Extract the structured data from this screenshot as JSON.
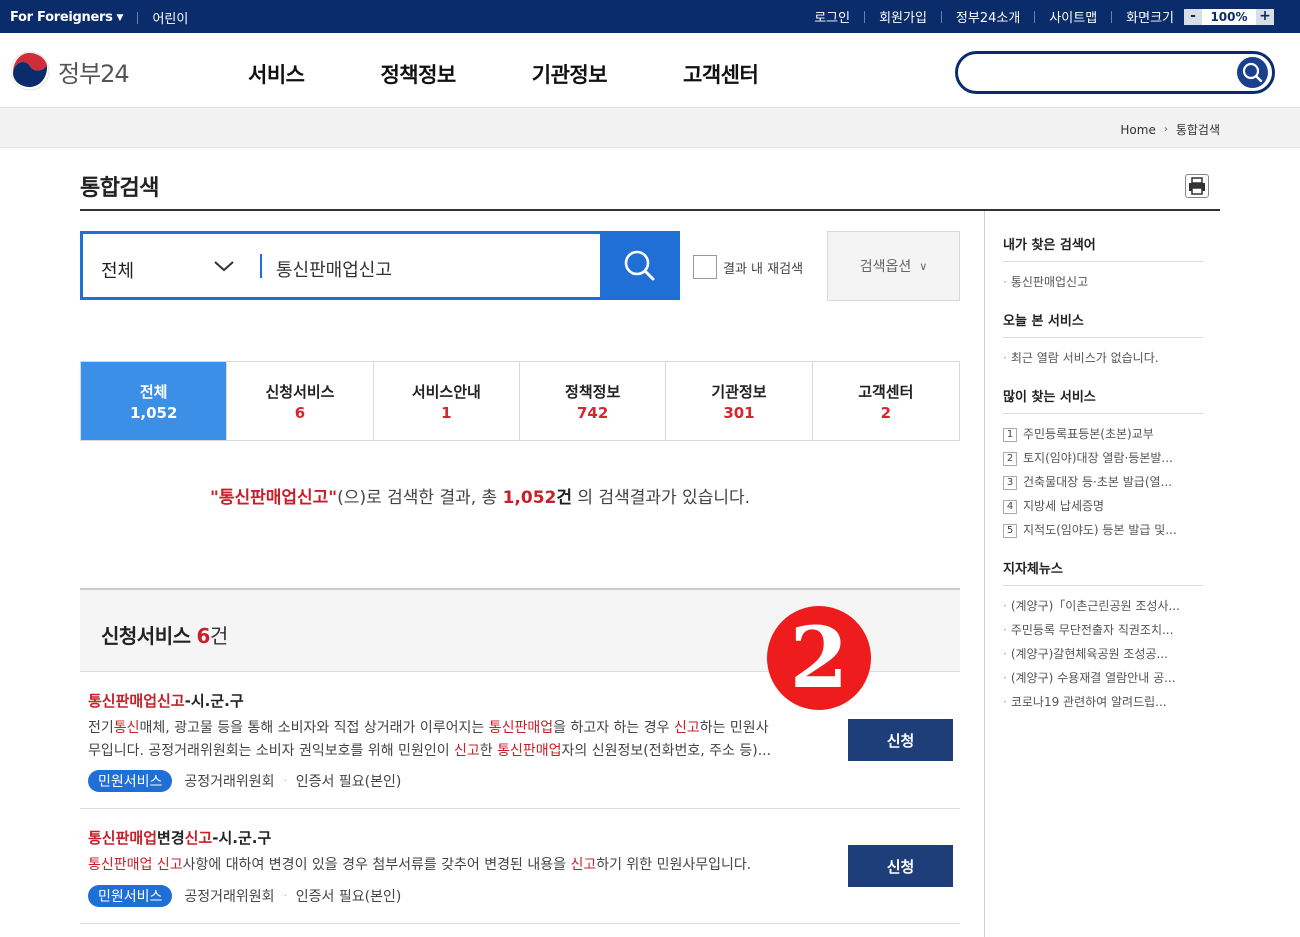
{
  "topbar": {
    "foreigners": "For Foreigners",
    "kids": "어린이",
    "links": [
      "로그인",
      "회원가입",
      "정부24소개",
      "사이트맵"
    ],
    "zoom_label": "화면크기",
    "zoom_minus": "-",
    "zoom_value": "100%",
    "zoom_plus": "+"
  },
  "header": {
    "logo_text": "정부24",
    "nav": [
      "서비스",
      "정책정보",
      "기관정보",
      "고객센터"
    ],
    "search_placeholder": ""
  },
  "breadcrumb": {
    "home": "Home",
    "current": "통합검색"
  },
  "page_title": "통합검색",
  "search": {
    "category": "전체",
    "query": "통신판매업신고",
    "research_label": "결과 내 재검색",
    "options_label": "검색옵션"
  },
  "tabs": [
    {
      "label": "전체",
      "count": "1,052"
    },
    {
      "label": "신청서비스",
      "count": "6"
    },
    {
      "label": "서비스안내",
      "count": "1"
    },
    {
      "label": "정책정보",
      "count": "742"
    },
    {
      "label": "기관정보",
      "count": "301"
    },
    {
      "label": "고객센터",
      "count": "2"
    }
  ],
  "summary": {
    "keyword": "\"통신판매업신고\"",
    "text1": "(으)로 검색한 결과, 총 ",
    "total": "1,052",
    "unit": "건",
    "text2": " 의 검색결과가 있습니다."
  },
  "section": {
    "title": "신청서비스",
    "count": "6",
    "unit": "건"
  },
  "marker": "2",
  "results": [
    {
      "title_hl": "통신판매업신고",
      "title_rest": "-시.군.구",
      "desc_line1": [
        "전기",
        "통신",
        "매체, 광고물 등을 통해 소비자와 직접 상거래가 이루어지는 ",
        "통신판매업",
        "을 하고자 하는 경우 ",
        "신고",
        "하는 민원사"
      ],
      "desc_line2": [
        "무입니다. 공정거래위원회는 소비자 권익보호를 위해 민원인이 ",
        "신고",
        "한 ",
        "통신판매업",
        "자의 신원정보(전화번호, 주소 등)..."
      ],
      "tag": "민원서비스",
      "org": "공정거래위원회",
      "cert": "인증서 필요(본인)",
      "button": "신청"
    },
    {
      "title_hl1": "통신판매업",
      "title_mid": "변경",
      "title_hl2": "신고",
      "title_rest": "-시.군.구",
      "desc_line1": [
        "통신판매업 신고",
        "사항에 대하여 변경이 있을 경우 첨부서류를 갖추어 변경된 내용을 ",
        "신고",
        "하기 위한 민원사무입니다."
      ],
      "tag": "민원서비스",
      "org": "공정거래위원회",
      "cert": "인증서 필요(본인)",
      "button": "신청"
    }
  ],
  "sidebar": {
    "recent_search_title": "내가 찾은 검색어",
    "recent_search": [
      "통신판매업신고"
    ],
    "today_title": "오늘 본 서비스",
    "today": [
      "최근 열람 서비스가 없습니다."
    ],
    "popular_title": "많이 찾는 서비스",
    "popular": [
      {
        "rank": "1",
        "label": "주민등록표등본(초본)교부"
      },
      {
        "rank": "2",
        "label": "토지(임야)대장 열람·등본발..."
      },
      {
        "rank": "3",
        "label": "건축물대장 등·초본 발급(열..."
      },
      {
        "rank": "4",
        "label": "지방세 납세증명"
      },
      {
        "rank": "5",
        "label": "지적도(임야도) 등본 발급 및..."
      }
    ],
    "news_title": "지자체뉴스",
    "news": [
      "(계양구)「이촌근린공원 조성사...",
      "주민등록 무단전출자 직권조치...",
      "(계양구)갈현체육공원 조성공...",
      "(계양구) 수용재결 열람안내 공...",
      "코로나19 관련하여 알려드립..."
    ]
  }
}
